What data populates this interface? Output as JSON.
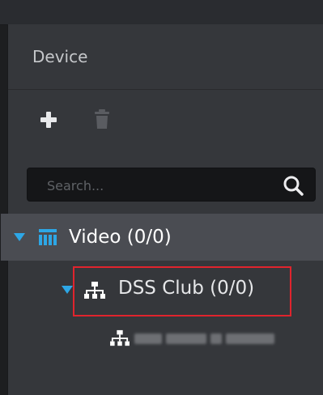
{
  "panel": {
    "title": "Device"
  },
  "toolbar": {
    "add_icon": "plus-icon",
    "delete_icon": "trash-icon"
  },
  "search": {
    "placeholder": "Search...",
    "icon": "search-icon"
  },
  "tree": {
    "root": {
      "label": "Video (0/0)",
      "icon": "device-group-icon",
      "expanded": true
    },
    "group": {
      "label": "DSS Club (0/0)",
      "icon": "network-node-icon",
      "expanded": true,
      "highlighted": true
    },
    "child": {
      "icon": "network-node-icon",
      "label_obscured": true
    }
  },
  "colors": {
    "accent": "#2da7e6",
    "highlight": "#e0242d",
    "selected_row": "#4a4c52",
    "panel_bg": "#35373b"
  }
}
